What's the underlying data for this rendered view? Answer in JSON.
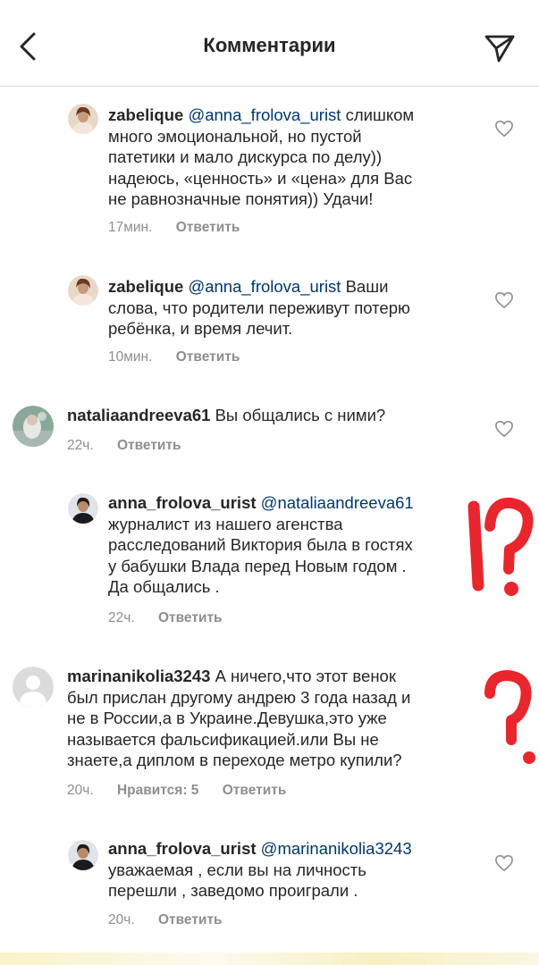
{
  "header": {
    "title": "Комментарии",
    "back_icon": "chevron-left-icon",
    "share_icon": "paper-plane-icon"
  },
  "comments": [
    {
      "username": "zabelique",
      "mention": "@anna_frolova_urist",
      "text": "слишком",
      "lines": [
        "много эмоциональной, но пустой",
        "патетики и мало дискурса по делу))",
        "надеюсь, «ценность» и «цена» для Вас",
        "не равнозначные понятия)) Удачи!"
      ],
      "time": "17мин.",
      "reply": "Ответить"
    },
    {
      "username": "zabelique",
      "mention": "@anna_frolova_urist",
      "text": "Ваши",
      "lines": [
        "слова, что родители переживут потерю",
        "ребёнка, и время лечит."
      ],
      "time": "10мин.",
      "reply": "Ответить"
    },
    {
      "username": "nataliaandreeva61",
      "text": "Вы общались с ними?",
      "time": "22ч.",
      "reply": "Ответить"
    },
    {
      "username": "anna_frolova_urist",
      "mention": "@nataliaandreeva61",
      "lines": [
        "журналист из нашего агенства",
        "расследований Виктория была в гостях",
        "у бабушки Влада перед Новым годом .",
        "Да общались ."
      ],
      "time": "22ч.",
      "reply": "Ответить"
    },
    {
      "username": "marinanikolia3243",
      "text": "А ничего,что этот венок",
      "lines": [
        "был прислан другому андрею 3 года назад и",
        "не в России,а в Украине.Девушка,это уже",
        "называется фальсификацией.или Вы не",
        "знаете,а диплом в переходе метро купили?"
      ],
      "time": "20ч.",
      "likes": "Нравится: 5",
      "reply": "Ответить"
    },
    {
      "username": "anna_frolova_urist",
      "mention": "@marinanikolia3243",
      "lines": [
        "уважаемая , если вы на личность",
        "перешли , заведомо проиграли ."
      ],
      "time": "20ч.",
      "reply": "Ответить"
    }
  ],
  "annotations": {
    "exclaim_question": "!?",
    "question": "?",
    "color": "#e8262d"
  },
  "colors": {
    "text": "#262626",
    "meta": "#8e8e8e",
    "mention": "#00376b",
    "divider": "#dbdbdb"
  }
}
